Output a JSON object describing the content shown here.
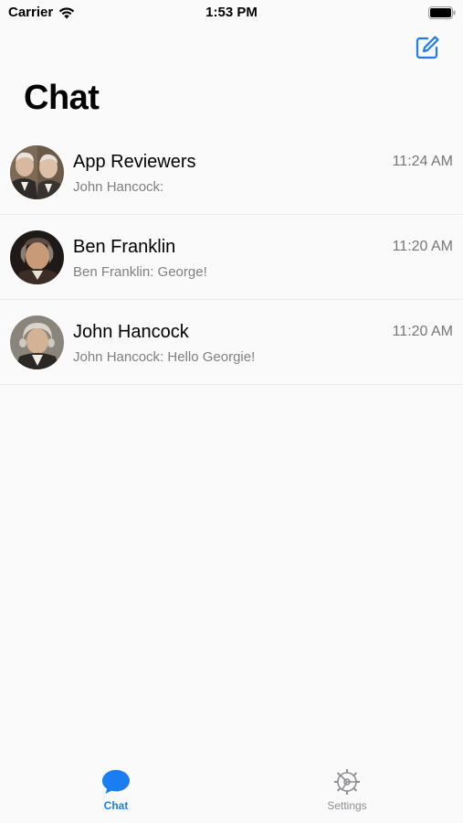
{
  "status_bar": {
    "carrier": "Carrier",
    "time": "1:53 PM"
  },
  "nav": {
    "title": "Chat",
    "compose_icon": "compose-icon"
  },
  "chats": [
    {
      "name": "App Reviewers",
      "time": "11:24 AM",
      "preview": "John Hancock:",
      "avatar": "group-portrait-avatar"
    },
    {
      "name": "Ben Franklin",
      "time": "11:20 AM",
      "preview": "Ben Franklin: George!",
      "avatar": "franklin-portrait-avatar"
    },
    {
      "name": "John Hancock",
      "time": "11:20 AM",
      "preview": "John Hancock: Hello Georgie!",
      "avatar": "hancock-portrait-avatar"
    }
  ],
  "tab_bar": {
    "tabs": [
      {
        "label": "Chat",
        "icon": "speech-bubble-icon",
        "selected": true
      },
      {
        "label": "Settings",
        "icon": "gear-icon",
        "selected": false
      }
    ]
  },
  "colors": {
    "accent": "#1a7ef2",
    "background": "#fafafa",
    "secondary_text": "#808080",
    "separator": "#ececec"
  }
}
